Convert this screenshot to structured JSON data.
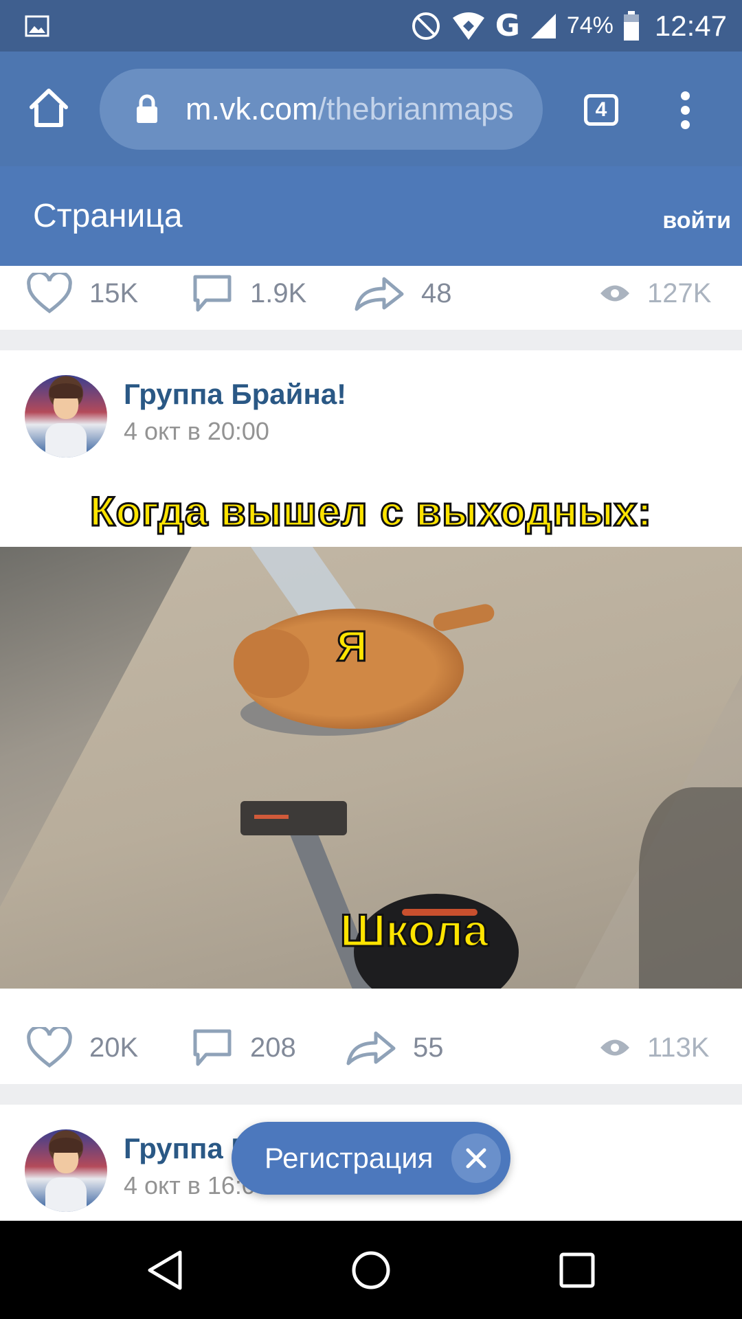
{
  "status_bar": {
    "battery_percent": "74%",
    "network": "G",
    "time": "12:47",
    "icons": [
      "gallery-icon",
      "do-not-disturb-icon",
      "wifi-icon",
      "signal-icon",
      "battery-icon"
    ]
  },
  "browser": {
    "url_host": "m.vk.com",
    "url_path": "/thebrianmaps",
    "tab_count": "4"
  },
  "vk_header": {
    "title": "Страница",
    "login": "войти"
  },
  "prev_post": {
    "likes": "15K",
    "comments": "1.9K",
    "shares": "48",
    "views": "127K"
  },
  "post": {
    "author": "Группа Брайна!",
    "date": "4 окт в 20:00",
    "caption": "Когда вышел с выходных:",
    "label_me": "Я",
    "label_school": "Школа",
    "likes": "20K",
    "comments": "208",
    "shares": "55",
    "views": "113K"
  },
  "next_post": {
    "author": "Группа Брайна!",
    "date": "4 окт в 16:00"
  },
  "registration": {
    "label": "Регистрация"
  },
  "colors": {
    "status_bar": "#3f5f8f",
    "browser_bar": "#4d76b0",
    "vk_header": "#4e79b8",
    "link": "#2a5885",
    "meta_gray": "#828a99",
    "meme_yellow": "#ffe400"
  }
}
